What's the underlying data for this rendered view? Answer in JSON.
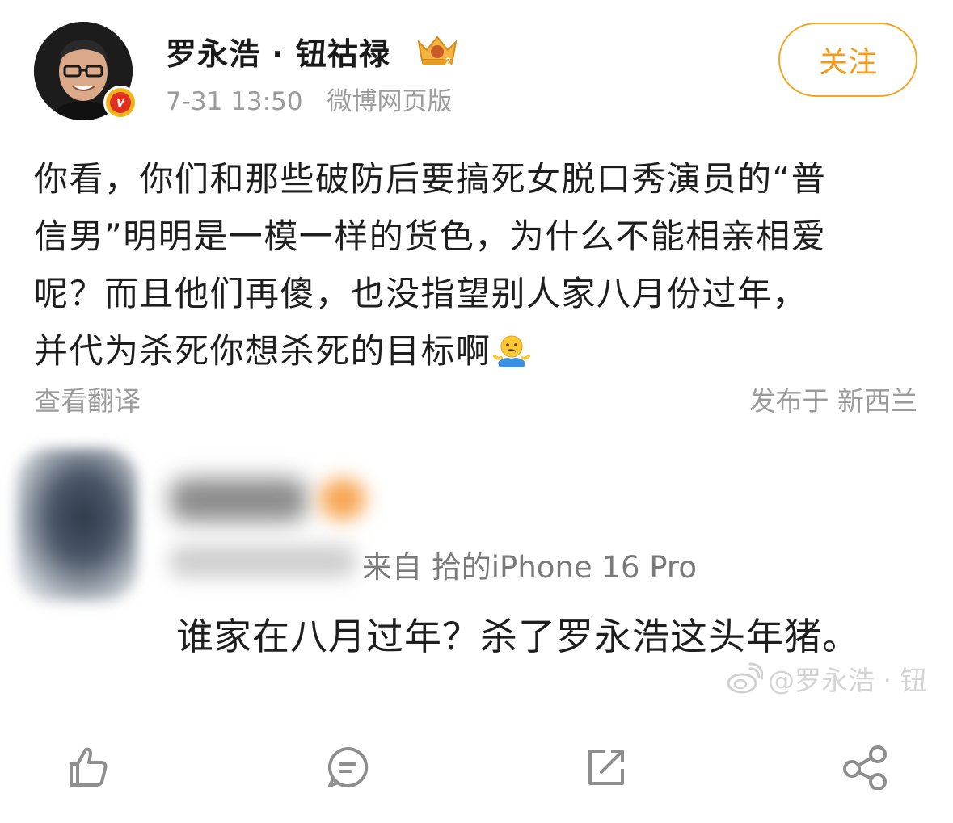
{
  "author": {
    "name": "罗永浩 · 钮祜禄",
    "timestamp": "7-31 13:50",
    "source": "微博网页版",
    "verified_icon": "red-v-verified-icon",
    "vip_icon": "crown-icon"
  },
  "follow_label": "关注",
  "post": {
    "line1": "你看，你们和那些破防后要搞死女脱口秀演员的“普",
    "line2": "信男”明明是一模一样的货色，为什么不能相亲相爱",
    "line3": "呢？而且他们再傻，也没指望别人家八月份过年，",
    "line4": "并代为杀死你想杀死的目标啊",
    "emoji": "shrug-emoji"
  },
  "translate_label": "查看翻译",
  "location_label": "发布于 新西兰",
  "embedded": {
    "device_line": "来自 拾的iPhone 16 Pro",
    "comment": "谁家在八月过年？杀了罗永浩这头年猪。",
    "watermark": "@罗永浩 · 钮"
  },
  "actions": [
    "thumbs-up-icon",
    "comment-icon",
    "share-edit-icon",
    "share-icon"
  ],
  "colors": {
    "accent": "#f29b17",
    "muted_text": "#9b9b9b",
    "icon": "#8e8e8e"
  }
}
